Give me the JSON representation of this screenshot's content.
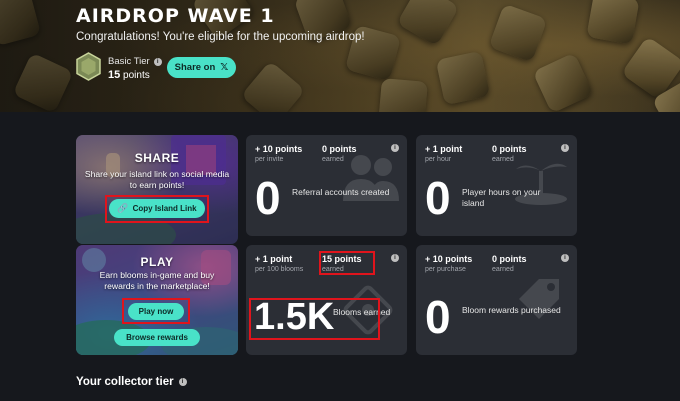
{
  "hero": {
    "title": "AIRDROP WAVE 1",
    "subtitle": "Congratulations! You're eligible for the upcoming airdrop!",
    "tier_name": "Basic Tier",
    "tier_points_value": "15",
    "tier_points_unit": "points",
    "share_label": "Share on",
    "share_icon": "x-logo-icon"
  },
  "share_card": {
    "title": "SHARE",
    "text": "Share your island link on social media to earn points!",
    "button_label": "Copy Island Link",
    "button_icon": "link-icon"
  },
  "play_card": {
    "title": "PLAY",
    "text": "Earn blooms in-game and buy rewards in the marketplace!",
    "play_label": "Play now",
    "browse_label": "Browse rewards"
  },
  "stats": [
    {
      "rate": "+ 10 points",
      "rate_sub": "per invite",
      "earned": "0 points",
      "earned_sub": "earned",
      "big": "0",
      "desc": "Referral accounts created",
      "icon": "people-icon"
    },
    {
      "rate": "+ 1 point",
      "rate_sub": "per hour",
      "earned": "0 points",
      "earned_sub": "earned",
      "big": "0",
      "desc": "Player hours on your island",
      "icon": "island-icon"
    },
    {
      "rate": "+ 1 point",
      "rate_sub": "per 100 blooms",
      "earned": "15 points",
      "earned_sub": "earned",
      "big": "1.5K",
      "desc": "Blooms earned",
      "icon": "bloom-icon"
    },
    {
      "rate": "+ 10 points",
      "rate_sub": "per purchase",
      "earned": "0 points",
      "earned_sub": "earned",
      "big": "0",
      "desc": "Bloom rewards purchased",
      "icon": "tag-icon"
    }
  ],
  "collector": {
    "title": "Your collector tier"
  },
  "colors": {
    "accent": "#49e2c8",
    "highlight": "#e0141c",
    "background": "#16181d",
    "card": "#2b2e35"
  }
}
